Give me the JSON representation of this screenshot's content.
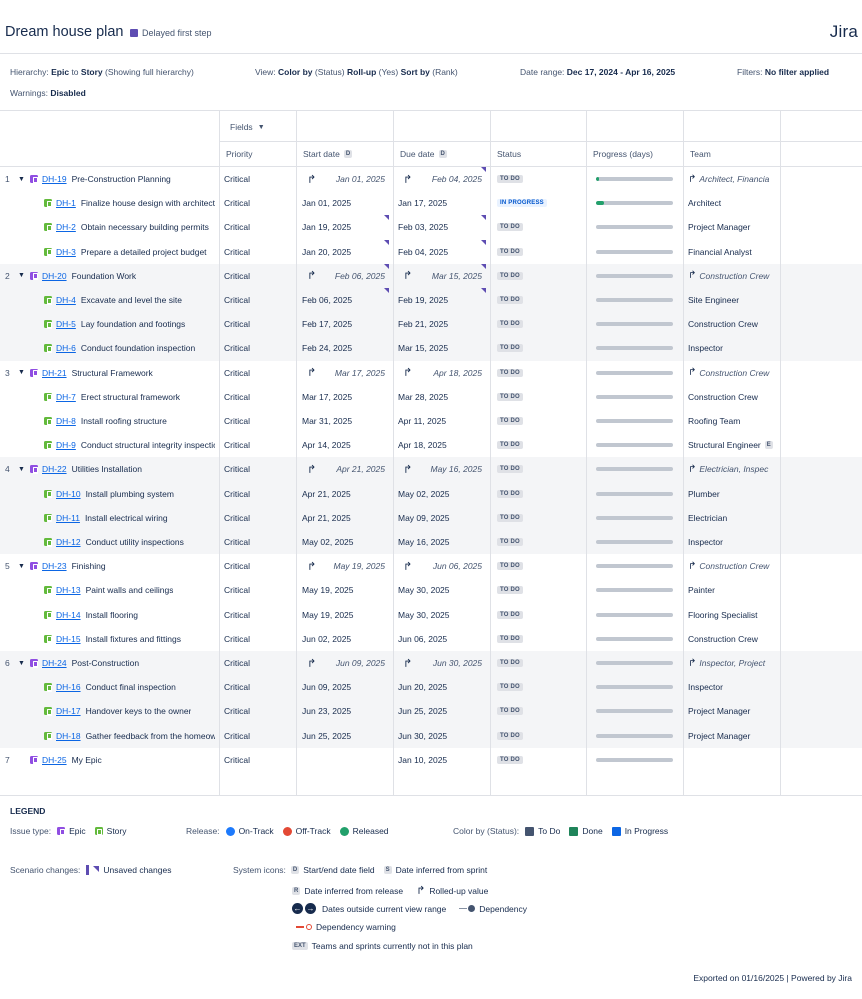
{
  "header": {
    "title": "Dream house plan",
    "scenario_label": "Delayed first step",
    "brand": "Jira"
  },
  "meta": {
    "hierarchy_label": "Hierarchy:",
    "hierarchy_from": "Epic",
    "hierarchy_to_word": "to",
    "hierarchy_to": "Story",
    "hierarchy_note": "(Showing full hierarchy)",
    "view_label": "View:",
    "color_by_key": "Color by",
    "color_by_val": "(Status)",
    "rollup_key": "Roll-up",
    "rollup_val": "(Yes)",
    "sort_key": "Sort by",
    "sort_val": "(Rank)",
    "date_range_label": "Date range:",
    "date_range_value": "Dec 17, 2024 - Apr 16, 2025",
    "filters_label": "Filters:",
    "filters_value": "No filter applied",
    "warnings_label": "Warnings:",
    "warnings_value": "Disabled"
  },
  "grid": {
    "fields_label": "Fields",
    "columns": {
      "priority": "Priority",
      "start_date": "Start date",
      "due_date": "Due date",
      "status": "Status",
      "progress": "Progress (days)",
      "team": "Team",
      "date_badge": "D"
    }
  },
  "rows": [
    {
      "num": "1",
      "type": "epic",
      "expand": true,
      "key": "DH-19",
      "summary": "Pre-Construction Planning",
      "priority": "Critical",
      "start": "Jan 01, 2025",
      "due": "Feb 04, 2025",
      "rolled": true,
      "status": "TO DO",
      "progress": 0.04,
      "team": "Architect, Financia",
      "team_rolled": true,
      "due_flag": true
    },
    {
      "num": "",
      "type": "story",
      "key": "DH-1",
      "summary": "Finalize house design with architect",
      "priority": "Critical",
      "start": "Jan 01, 2025",
      "due": "Jan 17, 2025",
      "status": "IN PROGRESS",
      "progress": 0.1,
      "team": "Architect"
    },
    {
      "num": "",
      "type": "story",
      "key": "DH-2",
      "summary": "Obtain necessary building permits",
      "priority": "Critical",
      "start": "Jan 19, 2025",
      "due": "Feb 03, 2025",
      "status": "TO DO",
      "progress": 0,
      "team": "Project Manager",
      "start_flag": true,
      "due_flag": true
    },
    {
      "num": "",
      "type": "story",
      "key": "DH-3",
      "summary": "Prepare a detailed project budget",
      "priority": "Critical",
      "start": "Jan 20, 2025",
      "due": "Feb 04, 2025",
      "status": "TO DO",
      "progress": 0,
      "team": "Financial Analyst",
      "start_flag": true,
      "due_flag": true
    },
    {
      "num": "2",
      "type": "epic",
      "expand": true,
      "key": "DH-20",
      "summary": "Foundation Work",
      "priority": "Critical",
      "start": "Feb 06, 2025",
      "due": "Mar 15, 2025",
      "rolled": true,
      "status": "TO DO",
      "progress": 0,
      "team": "Construction Crew",
      "team_rolled": true,
      "start_flag": true,
      "due_flag": true
    },
    {
      "num": "",
      "type": "story",
      "key": "DH-4",
      "summary": "Excavate and level the site",
      "priority": "Critical",
      "start": "Feb 06, 2025",
      "due": "Feb 19, 2025",
      "status": "TO DO",
      "progress": 0,
      "team": "Site Engineer",
      "start_flag": true,
      "due_flag": true
    },
    {
      "num": "",
      "type": "story",
      "key": "DH-5",
      "summary": "Lay foundation and footings",
      "priority": "Critical",
      "start": "Feb 17, 2025",
      "due": "Feb 21, 2025",
      "status": "TO DO",
      "progress": 0,
      "team": "Construction Crew"
    },
    {
      "num": "",
      "type": "story",
      "key": "DH-6",
      "summary": "Conduct foundation inspection",
      "priority": "Critical",
      "start": "Feb 24, 2025",
      "due": "Mar 15, 2025",
      "status": "TO DO",
      "progress": 0,
      "team": "Inspector"
    },
    {
      "num": "3",
      "type": "epic",
      "expand": true,
      "key": "DH-21",
      "summary": "Structural Framework",
      "priority": "Critical",
      "start": "Mar 17, 2025",
      "due": "Apr 18, 2025",
      "rolled": true,
      "status": "TO DO",
      "progress": 0,
      "team": "Construction Crew",
      "team_rolled": true
    },
    {
      "num": "",
      "type": "story",
      "key": "DH-7",
      "summary": "Erect structural framework",
      "priority": "Critical",
      "start": "Mar 17, 2025",
      "due": "Mar 28, 2025",
      "status": "TO DO",
      "progress": 0,
      "team": "Construction Crew"
    },
    {
      "num": "",
      "type": "story",
      "key": "DH-8",
      "summary": "Install roofing structure",
      "priority": "Critical",
      "start": "Mar 31, 2025",
      "due": "Apr 11, 2025",
      "status": "TO DO",
      "progress": 0,
      "team": "Roofing Team"
    },
    {
      "num": "",
      "type": "story",
      "key": "DH-9",
      "summary": "Conduct structural integrity inspection",
      "priority": "Critical",
      "start": "Apr 14, 2025",
      "due": "Apr 18, 2025",
      "status": "TO DO",
      "progress": 0,
      "team": "Structural Engineer",
      "team_badge": "E"
    },
    {
      "num": "4",
      "type": "epic",
      "expand": true,
      "key": "DH-22",
      "summary": "Utilities Installation",
      "priority": "Critical",
      "start": "Apr 21, 2025",
      "due": "May 16, 2025",
      "rolled": true,
      "status": "TO DO",
      "progress": 0,
      "team": "Electrician, Inspec",
      "team_rolled": true
    },
    {
      "num": "",
      "type": "story",
      "key": "DH-10",
      "summary": "Install plumbing system",
      "priority": "Critical",
      "start": "Apr 21, 2025",
      "due": "May 02, 2025",
      "status": "TO DO",
      "progress": 0,
      "team": "Plumber"
    },
    {
      "num": "",
      "type": "story",
      "key": "DH-11",
      "summary": "Install electrical wiring",
      "priority": "Critical",
      "start": "Apr 21, 2025",
      "due": "May 09, 2025",
      "status": "TO DO",
      "progress": 0,
      "team": "Electrician"
    },
    {
      "num": "",
      "type": "story",
      "key": "DH-12",
      "summary": "Conduct utility inspections",
      "priority": "Critical",
      "start": "May 02, 2025",
      "due": "May 16, 2025",
      "status": "TO DO",
      "progress": 0,
      "team": "Inspector"
    },
    {
      "num": "5",
      "type": "epic",
      "expand": true,
      "key": "DH-23",
      "summary": "Finishing",
      "priority": "Critical",
      "start": "May 19, 2025",
      "due": "Jun 06, 2025",
      "rolled": true,
      "status": "TO DO",
      "progress": 0,
      "team": "Construction Crew",
      "team_rolled": true
    },
    {
      "num": "",
      "type": "story",
      "key": "DH-13",
      "summary": "Paint walls and ceilings",
      "priority": "Critical",
      "start": "May 19, 2025",
      "due": "May 30, 2025",
      "status": "TO DO",
      "progress": 0,
      "team": "Painter"
    },
    {
      "num": "",
      "type": "story",
      "key": "DH-14",
      "summary": "Install flooring",
      "priority": "Critical",
      "start": "May 19, 2025",
      "due": "May 30, 2025",
      "status": "TO DO",
      "progress": 0,
      "team": "Flooring Specialist"
    },
    {
      "num": "",
      "type": "story",
      "key": "DH-15",
      "summary": "Install fixtures and fittings",
      "priority": "Critical",
      "start": "Jun 02, 2025",
      "due": "Jun 06, 2025",
      "status": "TO DO",
      "progress": 0,
      "team": "Construction Crew"
    },
    {
      "num": "6",
      "type": "epic",
      "expand": true,
      "key": "DH-24",
      "summary": "Post-Construction",
      "priority": "Critical",
      "start": "Jun 09, 2025",
      "due": "Jun 30, 2025",
      "rolled": true,
      "status": "TO DO",
      "progress": 0,
      "team": "Inspector, Project",
      "team_rolled": true
    },
    {
      "num": "",
      "type": "story",
      "key": "DH-16",
      "summary": "Conduct final inspection",
      "priority": "Critical",
      "start": "Jun 09, 2025",
      "due": "Jun 20, 2025",
      "status": "TO DO",
      "progress": 0,
      "team": "Inspector"
    },
    {
      "num": "",
      "type": "story",
      "key": "DH-17",
      "summary": "Handover keys to the owner",
      "priority": "Critical",
      "start": "Jun 23, 2025",
      "due": "Jun 25, 2025",
      "status": "TO DO",
      "progress": 0,
      "team": "Project Manager"
    },
    {
      "num": "",
      "type": "story",
      "key": "DH-18",
      "summary": "Gather feedback from the homeowner",
      "priority": "Critical",
      "start": "Jun 25, 2025",
      "due": "Jun 30, 2025",
      "status": "TO DO",
      "progress": 0,
      "team": "Project Manager"
    },
    {
      "num": "7",
      "type": "epic",
      "expand": false,
      "key": "DH-25",
      "summary": "My Epic",
      "priority": "Critical",
      "start": "",
      "due": "Jan 10, 2025",
      "status": "TO DO",
      "progress": 0,
      "team": ""
    }
  ],
  "legend": {
    "title": "LEGEND",
    "issue_type_label": "Issue type:",
    "epic_label": "Epic",
    "story_label": "Story",
    "release_label": "Release:",
    "on_track": "On-Track",
    "off_track": "Off-Track",
    "released": "Released",
    "color_by_label": "Color by (Status):",
    "to_do": "To Do",
    "done": "Done",
    "in_progress": "In Progress",
    "scenario_label": "Scenario changes:",
    "unsaved": "Unsaved changes",
    "system_icons_label": "System icons:",
    "d_badge": "D",
    "start_end": "Start/end date field",
    "s_badge": "S",
    "from_sprint": "Date inferred from sprint",
    "r_badge": "R",
    "from_release": "Date inferred from release",
    "rolled_up": "Rolled-up value",
    "outside_view": "Dates outside current view range",
    "dependency": "Dependency",
    "dependency_warning": "Dependency warning",
    "ext_badge": "EXT",
    "ext_text": "Teams and sprints currently not in this plan",
    "colors": {
      "epic": "#904ee2",
      "story": "#63ba3c",
      "on_track": "#1d7afc",
      "off_track": "#e34935",
      "released": "#22a06b",
      "to_do": "#44546f",
      "done": "#1f845a",
      "in_progress": "#0c66e4",
      "scenario": "#5e4db2"
    }
  },
  "footer": "Exported on 01/16/2025 | Powered by Jira"
}
